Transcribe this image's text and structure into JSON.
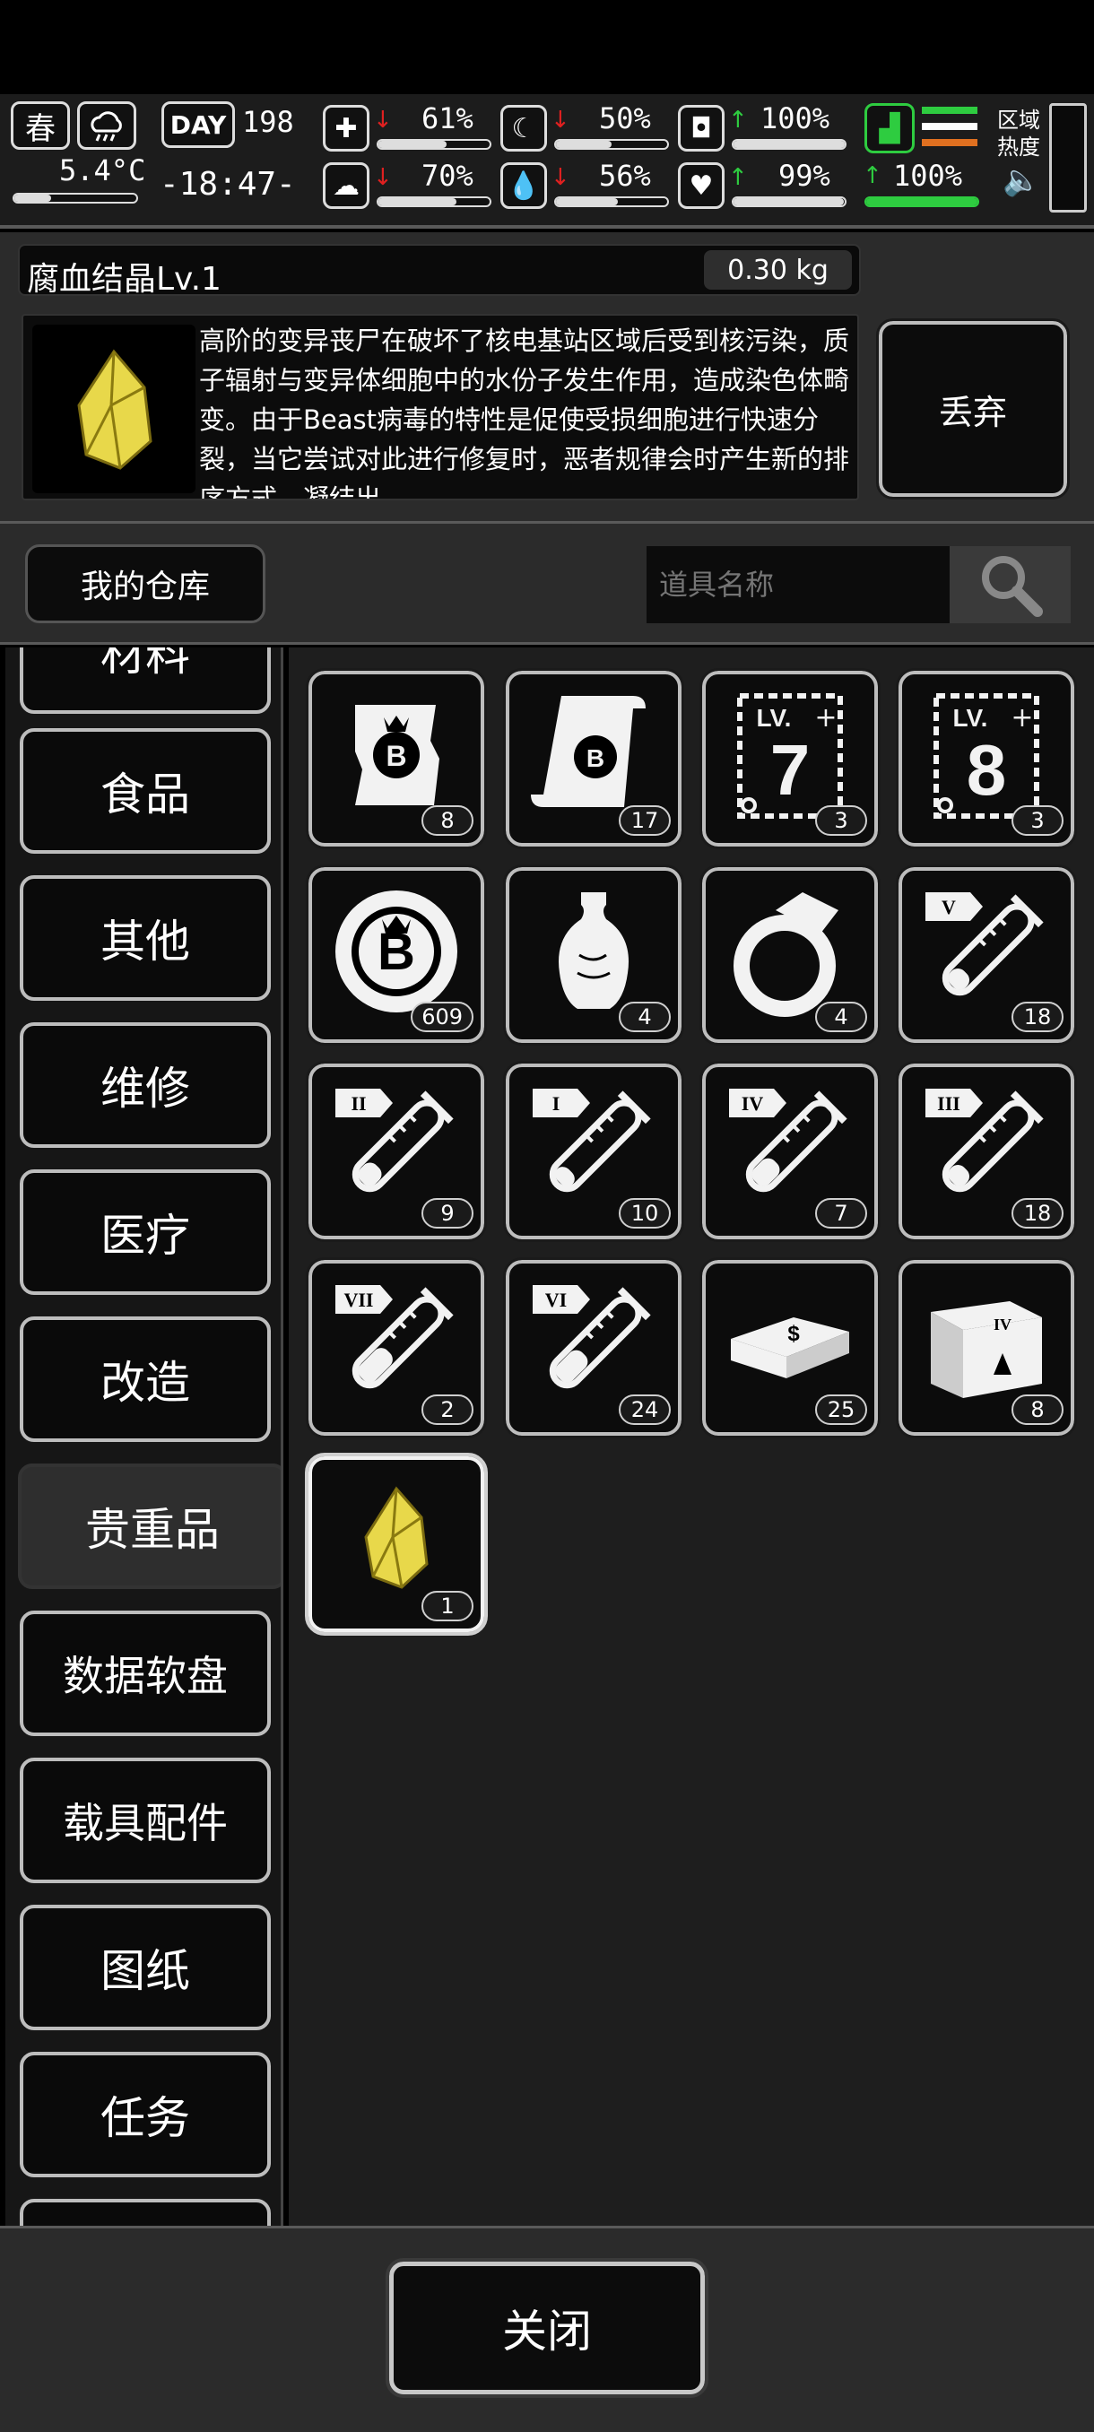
{
  "hud": {
    "season": "春",
    "temperature": "5.4°C",
    "day_label": "DAY",
    "day_value": "198",
    "clock": "-18:47-",
    "stats": [
      {
        "name": "health-kit",
        "value": "61%",
        "trend": "down",
        "level": 0.61
      },
      {
        "name": "stomach",
        "value": "50%",
        "trend": "down",
        "level": 0.5
      },
      {
        "name": "armor",
        "value": "100%",
        "trend": "up",
        "level": 1.0
      },
      {
        "name": "brain",
        "value": "70%",
        "trend": "down",
        "level": 0.7
      },
      {
        "name": "water",
        "value": "56%",
        "trend": "down",
        "level": 0.56
      },
      {
        "name": "heart",
        "value": "99%",
        "trend": "up",
        "level": 0.99
      },
      {
        "name": "stamina",
        "value": "100%",
        "trend": "up",
        "level": 1.0
      }
    ],
    "zone_heat_label": "区域\n热度"
  },
  "detail": {
    "item_name": "腐血结晶Lv.1",
    "weight": "0.30 kg",
    "description": "高阶的变异丧尸在破坏了核电基站区域后受到核污染，质子辐射与变异体细胞中的水份子发生作用，造成染色体畸变。由于Beast病毒的特性是促使受损细胞进行快速分裂，当它尝试对此进行修复时，恶者规律会时产生新的排序方式，凝结出",
    "discard_label": "丢弃"
  },
  "search": {
    "warehouse_label": "我的仓库",
    "placeholder": "道具名称"
  },
  "categories": [
    {
      "label": "材料",
      "active": false
    },
    {
      "label": "食品",
      "active": false
    },
    {
      "label": "其他",
      "active": false
    },
    {
      "label": "维修",
      "active": false
    },
    {
      "label": "医疗",
      "active": false
    },
    {
      "label": "改造",
      "active": false
    },
    {
      "label": "贵重品",
      "active": true
    },
    {
      "label": "数据软盘",
      "active": false
    },
    {
      "label": "载具配件",
      "active": false
    },
    {
      "label": "图纸",
      "active": false
    },
    {
      "label": "任务",
      "active": false
    }
  ],
  "items": [
    {
      "icon": "b-coupon-icon",
      "count": "8"
    },
    {
      "icon": "b-scroll-icon",
      "count": "17"
    },
    {
      "icon": "lv7-card-icon",
      "count": "3",
      "label": "LV.",
      "num": "7"
    },
    {
      "icon": "lv8-card-icon",
      "count": "3",
      "label": "LV.",
      "num": "8"
    },
    {
      "icon": "b-chip-icon",
      "count": "609"
    },
    {
      "icon": "vase-icon",
      "count": "4"
    },
    {
      "icon": "ring-icon",
      "count": "4"
    },
    {
      "icon": "test-tube-v-icon",
      "count": "18",
      "roman": "V",
      "fill": 0.3
    },
    {
      "icon": "test-tube-ii-icon",
      "count": "9",
      "roman": "II",
      "fill": 0.35
    },
    {
      "icon": "test-tube-i-icon",
      "count": "10",
      "roman": "I",
      "fill": 0.25
    },
    {
      "icon": "test-tube-iv-icon",
      "count": "7",
      "roman": "IV",
      "fill": 0.45
    },
    {
      "icon": "test-tube-iii-icon",
      "count": "18",
      "roman": "III",
      "fill": 0.3
    },
    {
      "icon": "test-tube-vii-icon",
      "count": "2",
      "roman": "VII",
      "fill": 0.6
    },
    {
      "icon": "test-tube-vi-icon",
      "count": "24",
      "roman": "VI",
      "fill": 0.55
    },
    {
      "icon": "cash-bundle-icon",
      "count": "25"
    },
    {
      "icon": "crate-iv-icon",
      "count": "8",
      "roman": "IV"
    },
    {
      "icon": "yellow-crystal-icon",
      "count": "1",
      "selected": true
    }
  ],
  "footer": {
    "close_label": "关闭"
  }
}
